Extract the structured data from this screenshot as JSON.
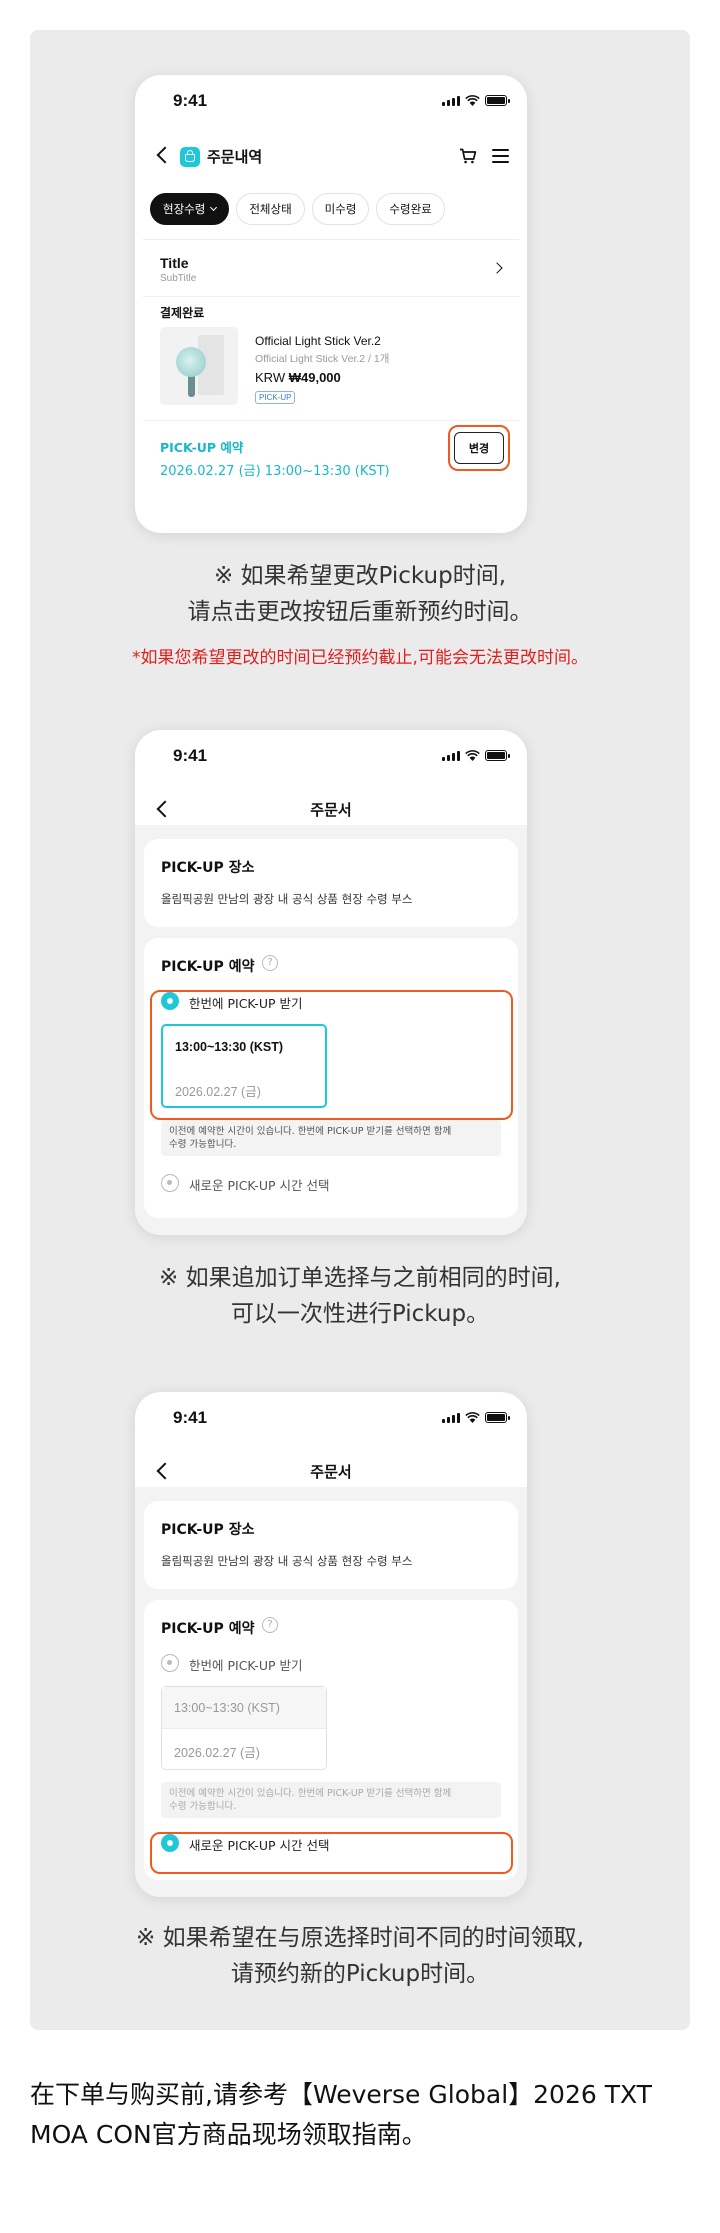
{
  "status_time": "9:41",
  "screen1": {
    "title": "주문내역",
    "chips": [
      "현장수령",
      "전체상태",
      "미수령",
      "수령완료"
    ],
    "card": {
      "title": "Title",
      "subtitle": "SubTitle",
      "status": "결제완료",
      "product_name": "Official Light Stick Ver.2",
      "product_option": "Official Light Stick Ver.2 / 1개",
      "price_currency": "KRW",
      "price_value": "₩49,000",
      "tag": "PICK-UP",
      "pickup_label": "PICK-UP 예약",
      "pickup_datetime": "2026.02.27 (금) 13:00~13:30 (KST)",
      "change_button": "변경"
    }
  },
  "caption1": {
    "line1": "※ 如果希望更改Pickup时间,",
    "line2": "请点击更改按钮后重新预约时间。",
    "warning": "*如果您希望更改的时间已经预约截止,可能会无法更改时间。"
  },
  "order_form": {
    "title": "주문서",
    "location_heading": "PICK-UP 장소",
    "location_text": "올림픽공원 만남의 광장 내 공식 상품 현장 수령 부스",
    "reservation_heading": "PICK-UP 예약",
    "help_glyph": "?",
    "option_once": "한번에 PICK-UP 받기",
    "slot_time": "13:00~13:30 (KST)",
    "slot_date": "2026.02.27 (금)",
    "note_line1": "이전에 예약한 시간이 있습니다.  한번에 PICK-UP 받기를 선택하면 함께",
    "note_line2": "수령 가능합니다.",
    "option_new": "새로운 PICK-UP 시간 선택"
  },
  "caption2": {
    "line1": "※ 如果追加订单选择与之前相同的时间,",
    "line2": "可以一次性进行Pickup。"
  },
  "caption3": {
    "line1": "※ 如果希望在与原选择时间不同的时间领取,",
    "line2": "请预约新的Pickup时间。"
  },
  "footer": {
    "line1": "在下单与购买前,请参考【Weverse Global】2026 TXT",
    "line2": "MOA CON官方商品现场领取指南。"
  },
  "colors": {
    "accent": "#1fc8d8",
    "highlight": "#ee5a1f",
    "warning": "#e01e1e",
    "panel": "#ebebeb"
  }
}
